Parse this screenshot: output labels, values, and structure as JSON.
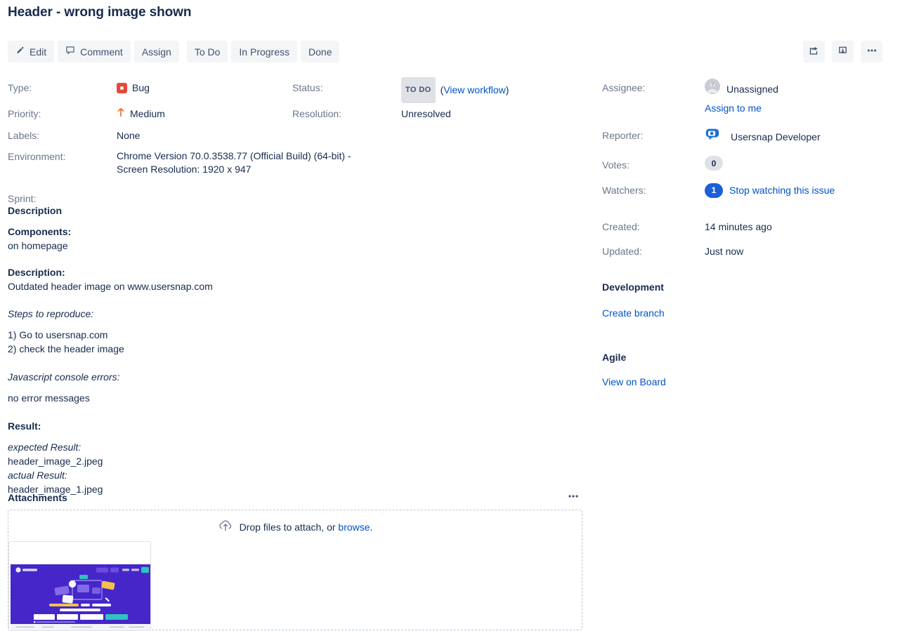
{
  "issue": {
    "title": "Header - wrong image shown"
  },
  "toolbar": {
    "edit_label": "Edit",
    "comment_label": "Comment",
    "assign_label": "Assign",
    "todo_label": "To Do",
    "inprogress_label": "In Progress",
    "done_label": "Done",
    "share_icon": "share-icon",
    "export_icon": "download-icon",
    "more_icon": "ellipsis-icon"
  },
  "fields": {
    "type_label": "Type:",
    "type_value": "Bug",
    "type_icon": "bug-icon",
    "status_label": "Status:",
    "status_value": "TO DO",
    "view_workflow": "View workflow",
    "priority_label": "Priority:",
    "priority_value": "Medium",
    "priority_icon": "arrow-up-icon",
    "resolution_label": "Resolution:",
    "resolution_value": "Unresolved",
    "labels_label": "Labels:",
    "labels_value": "None",
    "environment_label": "Environment:",
    "environment_value": "Chrome Version 70.0.3538.77 (Official Build) (64-bit) - Screen Resolution: 1920 x 947",
    "sprint_label": "Sprint:",
    "sprint_value": ""
  },
  "description": {
    "heading": "Description",
    "components_label": "Components:",
    "components_value": "on homepage",
    "description_label": "Description:",
    "description_value": "Outdated header image on www.usersnap.com",
    "steps_label": "Steps to reproduce:",
    "step_1": "1) Go to usersnap.com",
    "step_2": "2) check the header image",
    "console_label": "Javascript console errors:",
    "console_value": "no error messages",
    "result_label": "Result:",
    "expected_label": "expected Result:",
    "expected_value": "header_image_2.jpeg",
    "actual_label": "actual Result:",
    "actual_value": "header_image_1.jpeg"
  },
  "attachments": {
    "heading": "Attachments",
    "more_icon": "ellipsis-icon",
    "drop_text": "Drop files to attach, or",
    "browse_link": "browse",
    "drop_suffix": ".",
    "upload_icon": "cloud-upload-icon",
    "thumbnail": {
      "name": "attachment-thumbnail",
      "hero_line_1_a": "Smart feedback",
      "hero_line_1_b": "for the",
      "hero_line_1_c": "products",
      "hero_line_2": "your customers love",
      "cta_label": "Try for free now",
      "bg_color": "#4526C9",
      "cta_color": "#2FC3C0"
    }
  },
  "sidebar": {
    "assignee_label": "Assignee:",
    "assignee_value": "Unassigned",
    "assignee_avatar": "unassigned-avatar-icon",
    "assign_to_me": "Assign to me",
    "reporter_label": "Reporter:",
    "reporter_value": "Usersnap Developer",
    "reporter_avatar": "usersnap-logo-icon",
    "votes_label": "Votes:",
    "votes_value": "0",
    "watchers_label": "Watchers:",
    "watchers_value": "1",
    "watchers_link": "Stop watching this issue",
    "created_label": "Created:",
    "created_value": "14 minutes ago",
    "updated_label": "Updated:",
    "updated_value": "Just now",
    "development_heading": "Development",
    "create_branch": "Create branch",
    "agile_heading": "Agile",
    "view_on_board": "View on Board"
  },
  "colors": {
    "link": "#0052CC",
    "bug_red": "#E5493A",
    "priority_orange": "#E9742C",
    "badge_grey": "#DFE1E6",
    "watcher_blue": "#1B5FD9",
    "text_navy": "#172B4D",
    "label_grey": "#6B778C"
  }
}
